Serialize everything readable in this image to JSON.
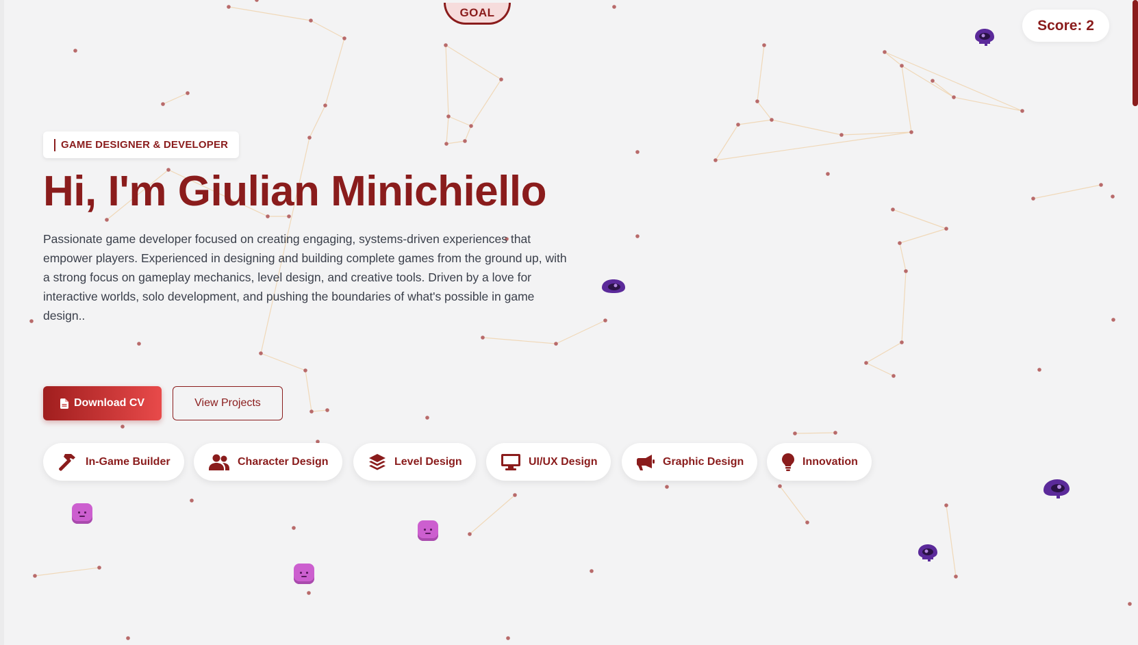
{
  "goal": {
    "label": "GOAL"
  },
  "score": {
    "text": "Score: 2"
  },
  "hero": {
    "role": "GAME DESIGNER & DEVELOPER",
    "title": "Hi, I'm Giulian Minichiello",
    "description": "Passionate game developer focused on creating engaging, systems-driven experiences that empower players. Experienced in designing and building complete games from the ground up, with a strong focus on gameplay mechanics, level design, and creative tools. Driven by a love for interactive worlds, solo development, and pushing the boundaries of what's possible in game design.."
  },
  "buttons": {
    "download_cv": "Download CV",
    "view_projects": "View Projects"
  },
  "skills": [
    {
      "label": "In-Game Builder",
      "icon": "hammer-icon"
    },
    {
      "label": "Character Design",
      "icon": "users-icon"
    },
    {
      "label": "Level Design",
      "icon": "layers-icon"
    },
    {
      "label": "UI/UX Design",
      "icon": "monitor-icon"
    },
    {
      "label": "Graphic Design",
      "icon": "megaphone-icon"
    },
    {
      "label": "Innovation",
      "icon": "lightbulb-icon"
    }
  ],
  "colors": {
    "accent": "#8a1c1c",
    "background": "#f3f3f4",
    "node": "#b86a6a",
    "link": "#f0d8b8",
    "blob": "#cc5fcf",
    "eye_creature": "#5b2a9a"
  }
}
